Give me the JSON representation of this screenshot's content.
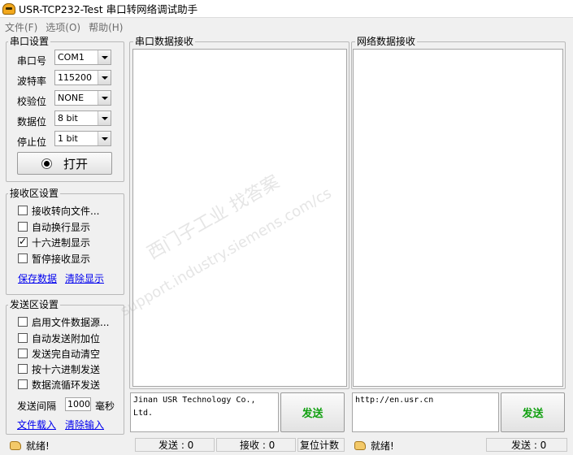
{
  "window": {
    "title": "USR-TCP232-Test 串口转网络调试助手"
  },
  "menu": [
    "文件(F)",
    "选项(O)",
    "帮助(H)"
  ],
  "serial_settings": {
    "title": "串口设置",
    "port_label": "串口号",
    "port_value": "COM1",
    "baud_label": "波特率",
    "baud_value": "115200",
    "parity_label": "校验位",
    "parity_value": "NONE",
    "databits_label": "数据位",
    "databits_value": "8 bit",
    "stopbits_label": "停止位",
    "stopbits_value": "1 bit",
    "open_button": "打开"
  },
  "receive_settings": {
    "title": "接收区设置",
    "options": [
      {
        "label": "接收转向文件...",
        "checked": false
      },
      {
        "label": "自动换行显示",
        "checked": false
      },
      {
        "label": "十六进制显示",
        "checked": true
      },
      {
        "label": "暂停接收显示",
        "checked": false
      }
    ],
    "save_link": "保存数据",
    "clear_link": "清除显示"
  },
  "send_settings": {
    "title": "发送区设置",
    "options": [
      {
        "label": "启用文件数据源...",
        "checked": false
      },
      {
        "label": "自动发送附加位",
        "checked": false
      },
      {
        "label": "发送完自动清空",
        "checked": false
      },
      {
        "label": "按十六进制发送",
        "checked": false
      },
      {
        "label": "数据流循环发送",
        "checked": false
      }
    ],
    "interval_label": "发送间隔",
    "interval_value": "1000",
    "interval_unit": "毫秒",
    "load_file_link": "文件载入",
    "clear_input_link": "清除输入"
  },
  "serial_receive": {
    "title": "串口数据接收"
  },
  "network_receive": {
    "title": "网络数据接收"
  },
  "serial_send": {
    "text": "Jinan USR Technology Co.,\nLtd.",
    "button": "发送"
  },
  "network_send": {
    "text": "http://en.usr.cn",
    "button": "发送"
  },
  "statusbar": {
    "left_status": "就绪!",
    "send_count": "发送 : 0",
    "recv_count": "接收 : 0",
    "reset_button": "复位计数",
    "right_status": "就绪!",
    "right_send_count": "发送 : 0"
  },
  "watermark": {
    "line1": "西门子工业 找答案",
    "line2": "support.industry.siemens.com/cs"
  }
}
